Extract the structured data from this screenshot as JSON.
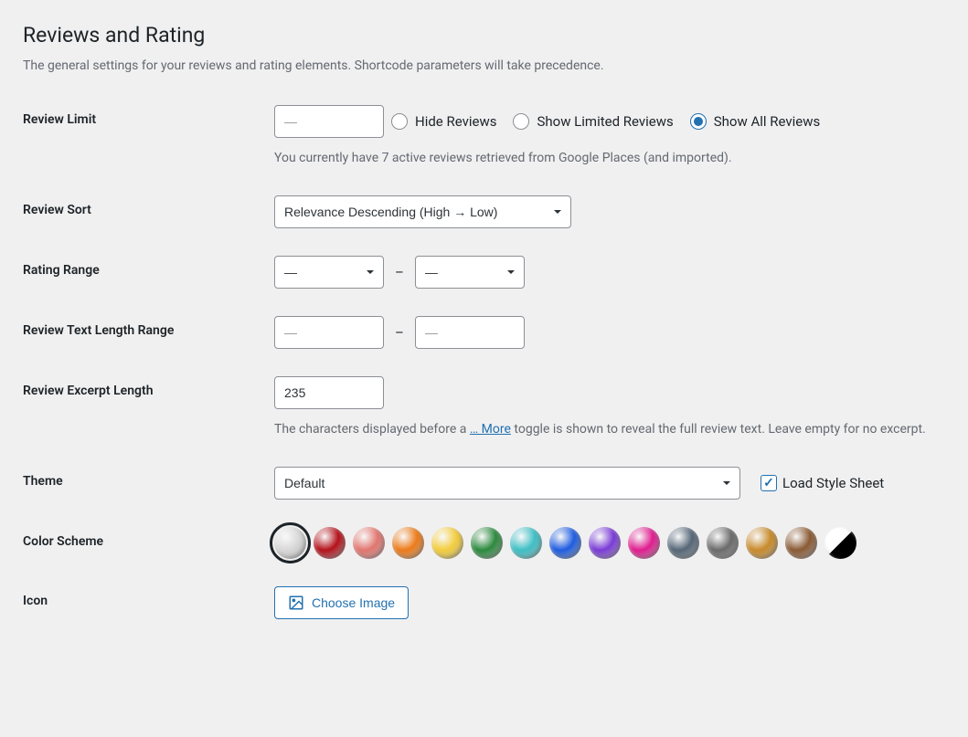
{
  "heading": "Reviews and Rating",
  "description": "The general settings for your reviews and rating elements. Shortcode parameters will take precedence.",
  "rows": {
    "review_limit": {
      "label": "Review Limit",
      "value": "",
      "placeholder": "—",
      "radios": [
        {
          "label": "Hide Reviews",
          "checked": false
        },
        {
          "label": "Show Limited Reviews",
          "checked": false
        },
        {
          "label": "Show All Reviews",
          "checked": true
        }
      ],
      "help": "You currently have 7 active reviews retrieved from Google Places (and imported)."
    },
    "review_sort": {
      "label": "Review Sort",
      "value": "Relevance Descending (High → Low)"
    },
    "rating_range": {
      "label": "Rating Range",
      "min_placeholder": "—",
      "max_placeholder": "—",
      "sep": "–"
    },
    "text_length_range": {
      "label": "Review Text Length Range",
      "min_placeholder": "—",
      "max_placeholder": "—",
      "sep": "–"
    },
    "excerpt_length": {
      "label": "Review Excerpt Length",
      "value": "235",
      "help_before": "The characters displayed before a ",
      "help_link": "… More",
      "help_after": " toggle is shown to reveal the full review text. Leave empty for no excerpt."
    },
    "theme": {
      "label": "Theme",
      "value": "Default",
      "checkbox_label": "Load Style Sheet",
      "checkbox_checked": true
    },
    "color_scheme": {
      "label": "Color Scheme",
      "colors": [
        {
          "name": "silver",
          "hex": "#d8d8d8",
          "selected": true
        },
        {
          "name": "red",
          "hex": "#b4121b",
          "selected": false
        },
        {
          "name": "coral",
          "hex": "#e2766f",
          "selected": false
        },
        {
          "name": "orange",
          "hex": "#ed7b19",
          "selected": false
        },
        {
          "name": "yellow",
          "hex": "#f3cd3d",
          "selected": false
        },
        {
          "name": "green",
          "hex": "#2b8a3e",
          "selected": false
        },
        {
          "name": "teal",
          "hex": "#3ebfc5",
          "selected": false
        },
        {
          "name": "blue",
          "hex": "#1f5de0",
          "selected": false
        },
        {
          "name": "purple",
          "hex": "#7a3cd6",
          "selected": false
        },
        {
          "name": "magenta",
          "hex": "#e01d8f",
          "selected": false
        },
        {
          "name": "slate",
          "hex": "#556677",
          "selected": false
        },
        {
          "name": "gray",
          "hex": "#6a6a6a",
          "selected": false
        },
        {
          "name": "amber",
          "hex": "#c88a2a",
          "selected": false
        },
        {
          "name": "brown",
          "hex": "#8a5a33",
          "selected": false
        },
        {
          "name": "half",
          "hex": "",
          "selected": false,
          "special": "half"
        }
      ]
    },
    "icon": {
      "label": "Icon",
      "button_label": "Choose Image"
    }
  }
}
